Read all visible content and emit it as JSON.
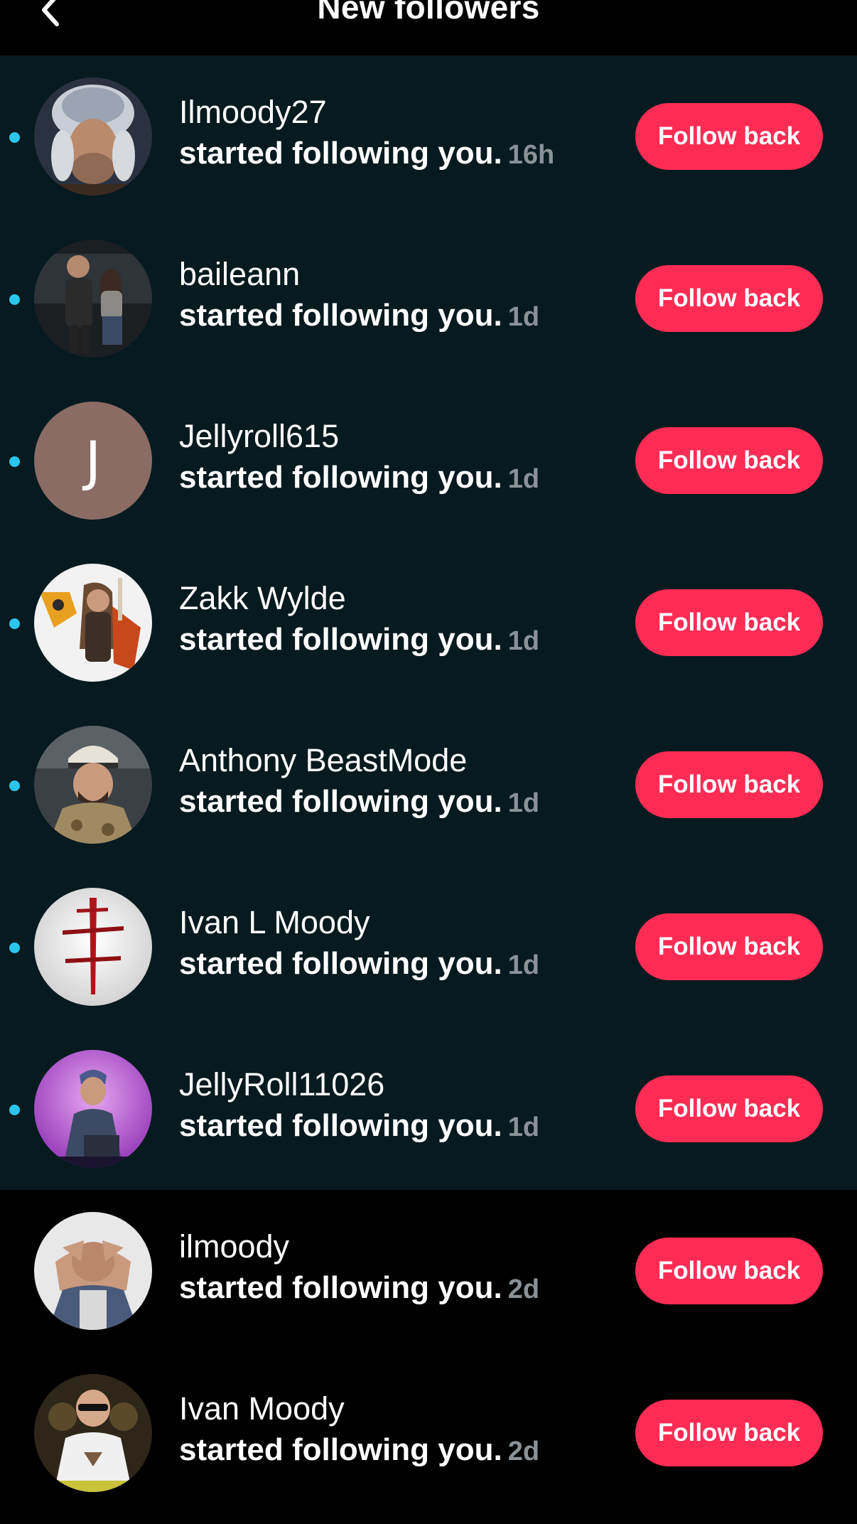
{
  "header": {
    "title": "New followers",
    "back_icon": "chevron-left-icon"
  },
  "colors": {
    "unread_bg": "#061a1f",
    "read_bg": "#000000",
    "accent": "#fe2c55",
    "unread_dot": "#2bc6ee",
    "time_text": "#8a9297"
  },
  "followers": [
    {
      "username": "Ilmoody27",
      "action": "started following you.",
      "time": "16h",
      "button": "Follow back",
      "unread": true,
      "avatar": "photo"
    },
    {
      "username": "baileann",
      "action": "started following you.",
      "time": "1d",
      "button": "Follow back",
      "unread": true,
      "avatar": "photo"
    },
    {
      "username": "Jellyroll615",
      "action": "started following you.",
      "time": "1d",
      "button": "Follow back",
      "unread": true,
      "avatar": "J"
    },
    {
      "username": "Zakk Wylde",
      "action": "started following you.",
      "time": "1d",
      "button": "Follow back",
      "unread": true,
      "avatar": "photo"
    },
    {
      "username": "Anthony BeastMode",
      "action": "started following you.",
      "time": "1d",
      "button": "Follow back",
      "unread": true,
      "avatar": "photo"
    },
    {
      "username": "Ivan L Moody",
      "action": "started following you.",
      "time": "1d",
      "button": "Follow back",
      "unread": true,
      "avatar": "photo"
    },
    {
      "username": "JellyRoll11026",
      "action": "started following you.",
      "time": "1d",
      "button": "Follow back",
      "unread": true,
      "avatar": "photo"
    },
    {
      "username": "ilmoody",
      "action": "started following you.",
      "time": "2d",
      "button": "Follow back",
      "unread": false,
      "avatar": "photo"
    },
    {
      "username": "Ivan Moody",
      "action": "started following you.",
      "time": "2d",
      "button": "Follow back",
      "unread": false,
      "avatar": "photo"
    }
  ]
}
